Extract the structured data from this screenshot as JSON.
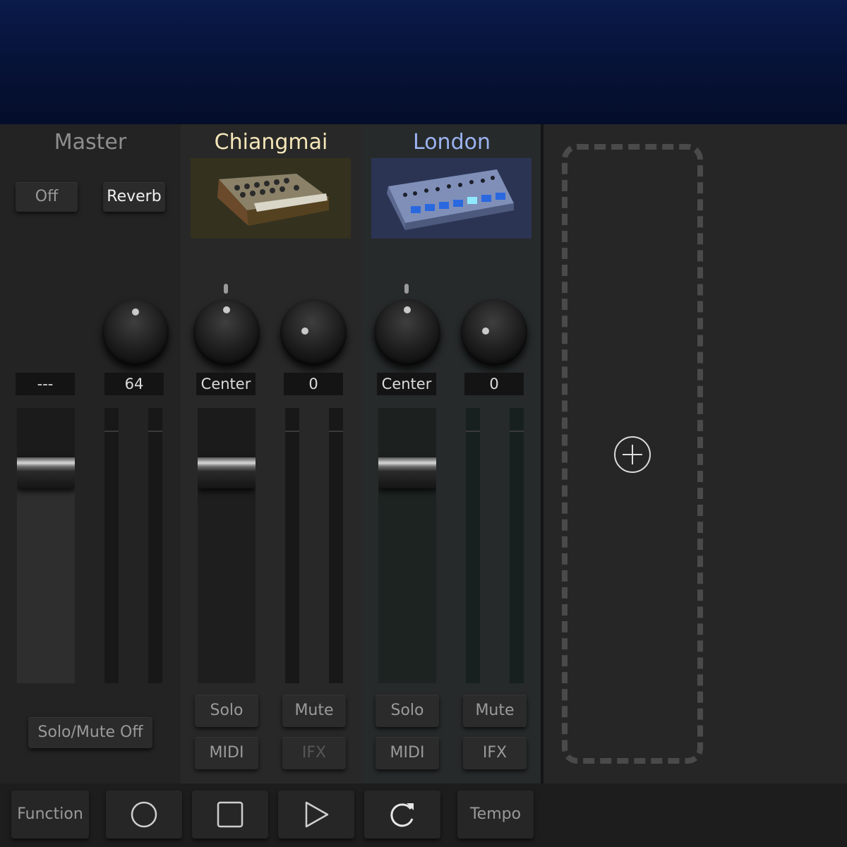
{
  "colors": {
    "master_name": "#8e8e8e",
    "chiangmai_name": "#f4e6b8",
    "london_name": "#9db3f2",
    "icon_stroke": "#cfcfcf"
  },
  "master": {
    "name": "Master",
    "off_button": "Off",
    "reverb_button": "Reverb",
    "left_value": "---",
    "knob_value": "64",
    "fader_level": 0.78,
    "solo_mute_button": "Solo/Mute Off"
  },
  "channels": [
    {
      "name": "Chiangmai",
      "thumbnail_icon": "synth-keyboard-icon",
      "pan_value": "Center",
      "send_value": "0",
      "fader_level": 0.78,
      "solo": "Solo",
      "mute": "Mute",
      "midi": "MIDI",
      "ifx": "IFX"
    },
    {
      "name": "London",
      "thumbnail_icon": "drum-machine-icon",
      "pan_value": "Center",
      "send_value": "0",
      "fader_level": 0.78,
      "solo": "Solo",
      "mute": "Mute",
      "midi": "MIDI",
      "ifx": "IFX"
    }
  ],
  "add_part_icon": "plus-circle-icon",
  "toolbar": {
    "function": "Function",
    "record_icon": "record-icon",
    "stop_icon": "stop-icon",
    "play_icon": "play-icon",
    "loop_icon": "loop-icon",
    "tempo": "Tempo"
  }
}
